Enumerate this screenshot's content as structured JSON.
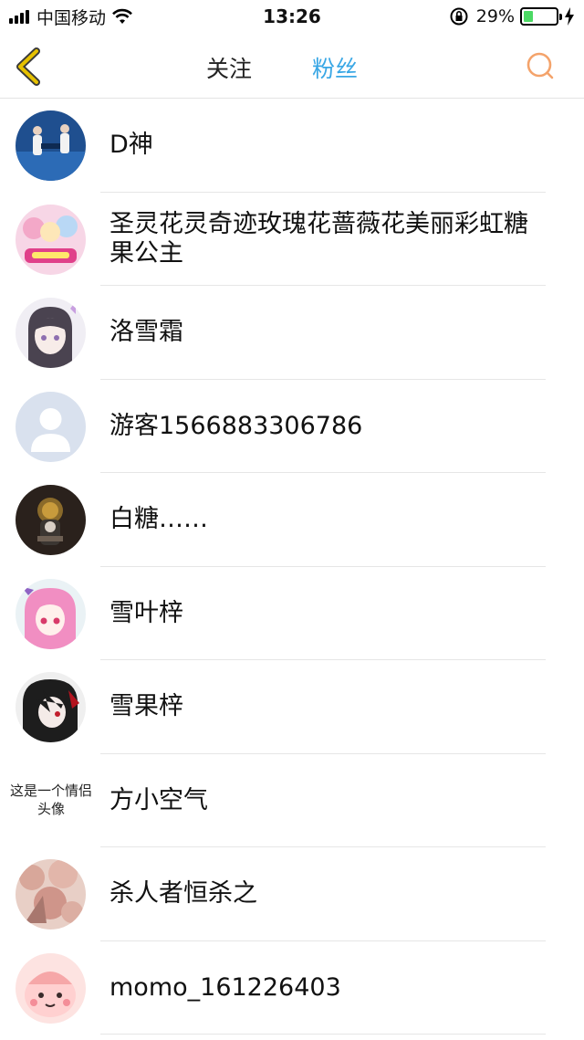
{
  "status_bar": {
    "carrier": "中国移动",
    "time": "13:26",
    "battery_percent": "29%",
    "battery_level": 0.29,
    "colors": {
      "battery_fill": "#4cd964"
    }
  },
  "nav": {
    "tabs": [
      {
        "label": "关注",
        "active": false
      },
      {
        "label": "粉丝",
        "active": true
      }
    ],
    "icons": {
      "back": "chevron-left-icon",
      "search": "search-icon"
    },
    "colors": {
      "active_tab": "#39a7e5",
      "back_icon": "#e6c100",
      "search_icon": "#f4a36b"
    }
  },
  "fans": [
    {
      "name": "D神",
      "avatar": "photo"
    },
    {
      "name": "圣灵花灵奇迹玫瑰花蔷薇花美丽彩虹糖果公主",
      "avatar": "photo"
    },
    {
      "name": "洛雪霜",
      "avatar": "photo"
    },
    {
      "name": "游客1566883306786",
      "avatar": "default-user-icon"
    },
    {
      "name": "白糖……",
      "avatar": "photo"
    },
    {
      "name": "雪叶梓",
      "avatar": "photo"
    },
    {
      "name": "雪果梓",
      "avatar": "photo"
    },
    {
      "name": "方小空气",
      "avatar": "text",
      "avatar_text": "这是一个情侣头像"
    },
    {
      "name": "杀人者恒杀之",
      "avatar": "photo"
    },
    {
      "name": "momo_161226403",
      "avatar": "photo"
    }
  ]
}
